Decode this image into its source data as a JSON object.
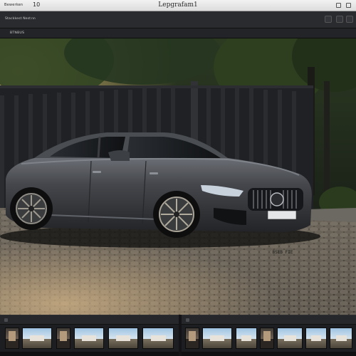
{
  "window": {
    "menu_label": "Bewerken",
    "menu_count": "10",
    "title": "Lepgrafam1"
  },
  "toolbar": {
    "mode_label": "Stackkest Nest",
    "mode_value": "nn"
  },
  "subbar": {
    "label": "BTNBUS"
  },
  "photo": {
    "subject": "car-photo",
    "plate_text": "BSEB FIE"
  },
  "filmstrip": {
    "panels": [
      {
        "thumbs": [
          "small",
          "wide",
          "small",
          "wide",
          "wide",
          "small"
        ]
      },
      {
        "thumbs": [
          "small",
          "wide",
          "wide",
          "small",
          "wide",
          "wide",
          "wide"
        ]
      }
    ]
  },
  "colors": {
    "titlebar": "#e6e6e6",
    "toolbar": "#2a2b2e",
    "car_body": "#3b3d42",
    "cobblestone": "#8e8579"
  }
}
